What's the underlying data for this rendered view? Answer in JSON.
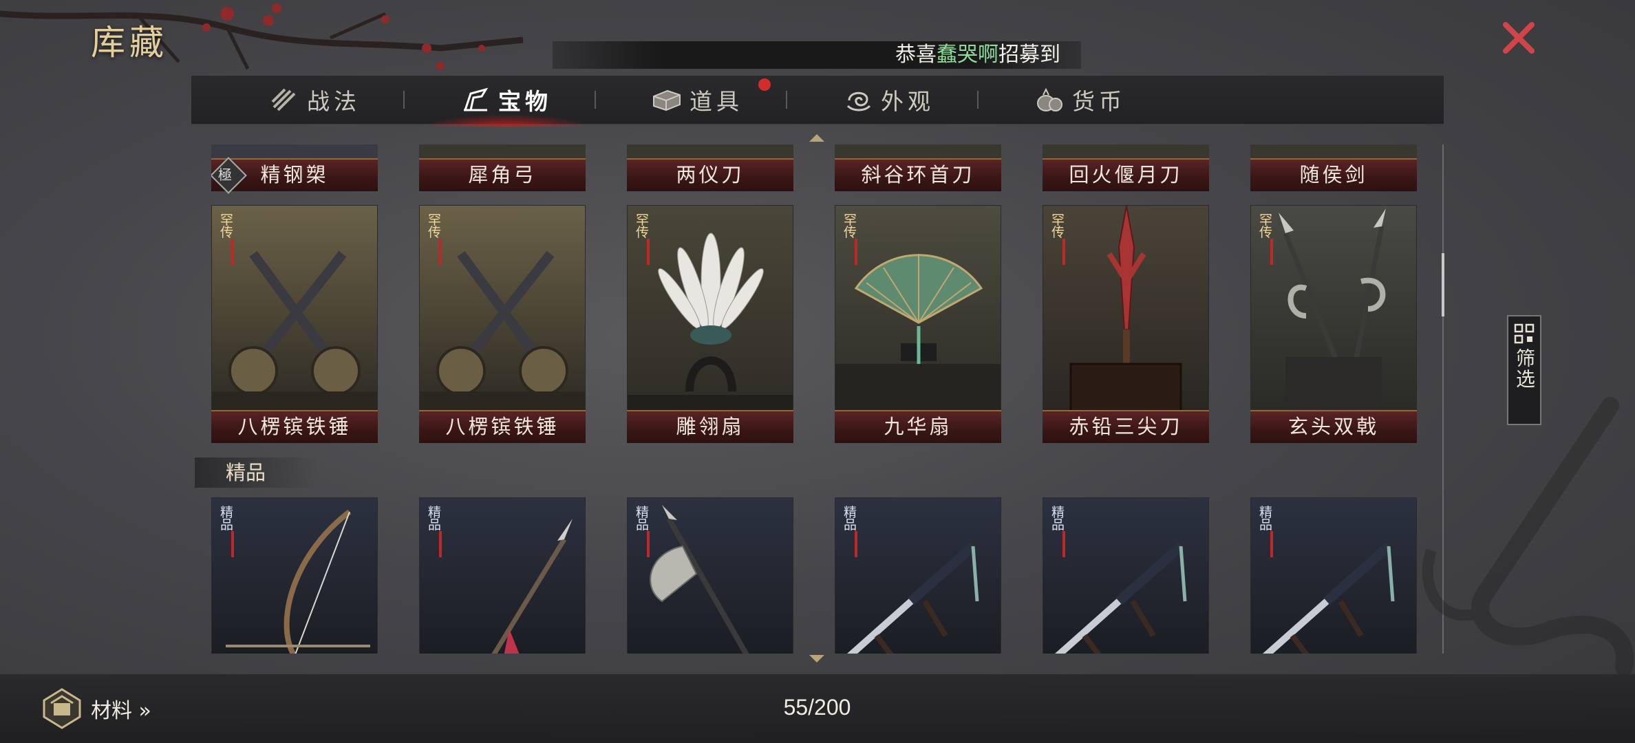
{
  "header": {
    "title": "库藏",
    "ticker": {
      "prefix": "恭喜",
      "player": "蠢哭啊",
      "suffix": "招募到"
    }
  },
  "tabs": [
    {
      "label": "战法",
      "icon": "scroll-icon",
      "active": false,
      "badge": false
    },
    {
      "label": "宝物",
      "icon": "treasure-icon",
      "active": true,
      "badge": false
    },
    {
      "label": "道具",
      "icon": "chest-icon",
      "active": false,
      "badge": true
    },
    {
      "label": "外观",
      "icon": "swirl-icon",
      "active": false,
      "badge": false
    },
    {
      "label": "货币",
      "icon": "money-bag-icon",
      "active": false,
      "badge": false
    }
  ],
  "rows": {
    "top_partial": [
      {
        "name": "精钢槊",
        "badge": "極"
      },
      {
        "name": "犀角弓"
      },
      {
        "name": "两仪刀"
      },
      {
        "name": "斜谷环首刀"
      },
      {
        "name": "回火偃月刀"
      },
      {
        "name": "随侯剑"
      }
    ],
    "legendary": [
      {
        "name": "八楞镔铁锤",
        "badge": "罕传",
        "art": "twin-hammers"
      },
      {
        "name": "八楞镔铁锤",
        "badge": "罕传",
        "art": "twin-hammers"
      },
      {
        "name": "雕翎扇",
        "badge": "罕传",
        "art": "feather-fan"
      },
      {
        "name": "九华扇",
        "badge": "罕传",
        "art": "folding-fan"
      },
      {
        "name": "赤铅三尖刀",
        "badge": "罕传",
        "art": "red-trident-blade"
      },
      {
        "name": "玄头双戟",
        "badge": "罕传",
        "art": "twin-halberds"
      }
    ],
    "fine_section_label": "精品",
    "fine": [
      {
        "badge": "精品",
        "art": "bow"
      },
      {
        "badge": "精品",
        "art": "spear"
      },
      {
        "badge": "精品",
        "art": "axe"
      },
      {
        "badge": "精品",
        "art": "saber"
      },
      {
        "badge": "精品",
        "art": "saber"
      },
      {
        "badge": "精品",
        "art": "saber"
      }
    ]
  },
  "filter": {
    "label": "筛选"
  },
  "footer": {
    "materials_label": "材料 »",
    "count": "55/200"
  },
  "colors": {
    "title_gold": "#e4cf9c",
    "highlight_green": "#8fdc9a",
    "close_red": "#d0454a",
    "badge_red": "#d42b2b",
    "namebar_red": "#5a2424"
  }
}
